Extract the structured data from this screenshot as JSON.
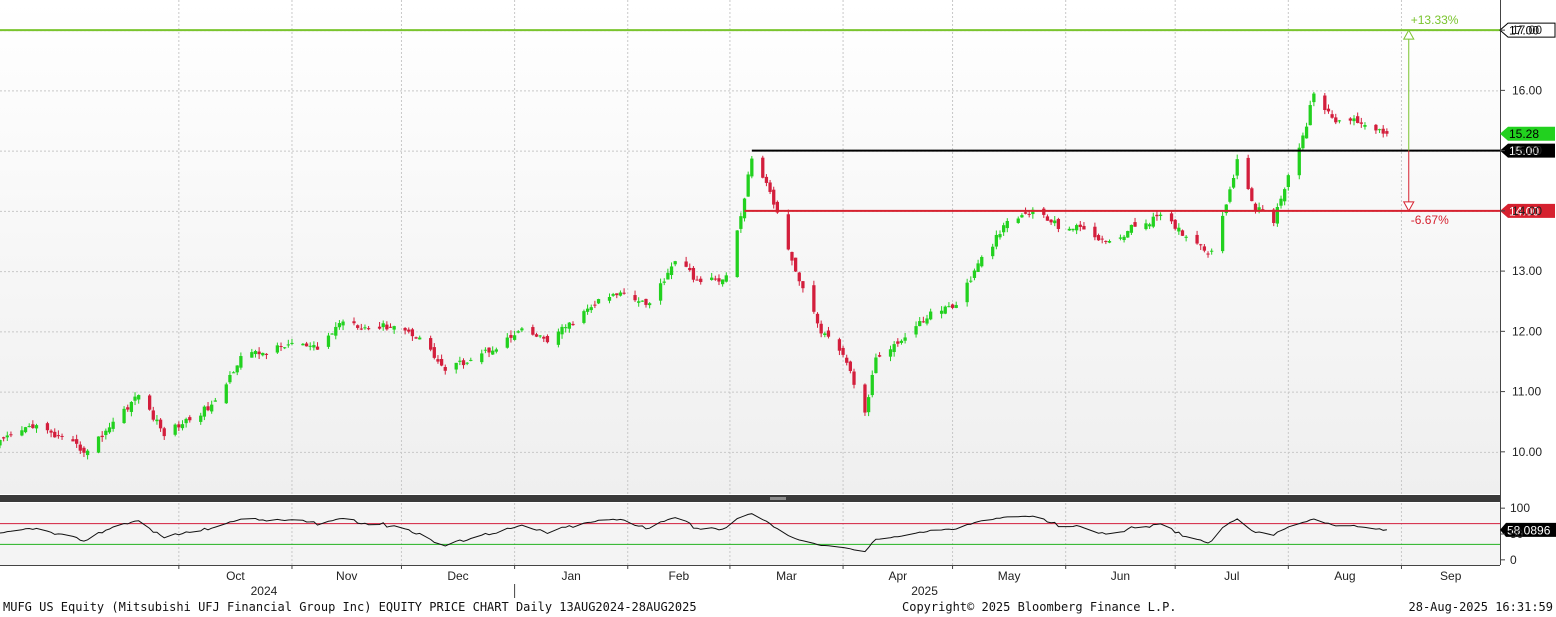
{
  "footer": {
    "left": "MUFG US Equity (Mitsubishi UFJ Financial Group Inc) EQUITY PRICE CHART  Daily 13AUG2024-28AUG2025",
    "center": "Copyright© 2025 Bloomberg Finance L.P.",
    "right": "28-Aug-2025 16:31:59"
  },
  "colors": {
    "up": "#22d11f",
    "down": "#d31e3c",
    "upper_target": "#7ac42e",
    "lower_target": "#d6212f",
    "support": "#000000",
    "last_price_tag": "#22d11f"
  },
  "chart_data": [
    {
      "type": "candlestick",
      "title": "",
      "x_range": [
        "2024-08-13",
        "2025-09-28"
      ],
      "x_ticks": [
        {
          "date": "2024-10-01",
          "label": "Oct"
        },
        {
          "date": "2024-11-01",
          "label": "Nov"
        },
        {
          "date": "2024-12-01",
          "label": "Dec"
        },
        {
          "date": "2025-01-01",
          "label": "Jan"
        },
        {
          "date": "2025-02-01",
          "label": "Feb"
        },
        {
          "date": "2025-03-01",
          "label": "Mar"
        },
        {
          "date": "2025-04-01",
          "label": "Apr"
        },
        {
          "date": "2025-05-01",
          "label": "May"
        },
        {
          "date": "2025-06-01",
          "label": "Jun"
        },
        {
          "date": "2025-07-01",
          "label": "Jul"
        },
        {
          "date": "2025-08-01",
          "label": "Aug"
        },
        {
          "date": "2025-09-01",
          "label": "Sep"
        }
      ],
      "year_labels": [
        {
          "date": "2024-11-01",
          "label": "2024"
        },
        {
          "date": "2025-05-01",
          "label": "2025"
        }
      ],
      "year_boundary": "2025-01-01",
      "y_range": [
        9.3,
        17.5
      ],
      "y_ticks": [
        10,
        11,
        12,
        13,
        14,
        15,
        16,
        17
      ],
      "y_tick_labels": [
        "10.00",
        "11.00",
        "12.00",
        "13.00",
        "14.00",
        "15.00",
        "16.00",
        "17.00"
      ],
      "grid": true,
      "close_anchors": [
        [
          "2024-08-13",
          10.15
        ],
        [
          "2024-08-22",
          10.45
        ],
        [
          "2024-08-30",
          10.2
        ],
        [
          "2024-09-06",
          10.0
        ],
        [
          "2024-09-13",
          10.5
        ],
        [
          "2024-09-20",
          10.95
        ],
        [
          "2024-09-27",
          10.3
        ],
        [
          "2024-10-04",
          10.55
        ],
        [
          "2024-10-11",
          10.8
        ],
        [
          "2024-10-18",
          11.6
        ],
        [
          "2024-10-25",
          11.65
        ],
        [
          "2024-11-01",
          11.8
        ],
        [
          "2024-11-08",
          11.7
        ],
        [
          "2024-11-15",
          12.2
        ],
        [
          "2024-11-22",
          12.05
        ],
        [
          "2024-11-29",
          12.1
        ],
        [
          "2024-12-06",
          11.9
        ],
        [
          "2024-12-13",
          11.35
        ],
        [
          "2024-12-20",
          11.55
        ],
        [
          "2024-12-27",
          11.75
        ],
        [
          "2025-01-03",
          12.0
        ],
        [
          "2025-01-10",
          11.85
        ],
        [
          "2025-01-17",
          12.15
        ],
        [
          "2025-01-24",
          12.5
        ],
        [
          "2025-01-31",
          12.65
        ],
        [
          "2025-02-07",
          12.45
        ],
        [
          "2025-02-14",
          13.2
        ],
        [
          "2025-02-21",
          12.8
        ],
        [
          "2025-02-28",
          12.9
        ],
        [
          "2025-03-04",
          13.9
        ],
        [
          "2025-03-07",
          14.9
        ],
        [
          "2025-03-12",
          14.3
        ],
        [
          "2025-03-14",
          14.0
        ],
        [
          "2025-03-19",
          13.0
        ],
        [
          "2025-03-26",
          12.0
        ],
        [
          "2025-04-02",
          11.5
        ],
        [
          "2025-04-07",
          10.6
        ],
        [
          "2025-04-10",
          11.6
        ],
        [
          "2025-04-17",
          11.85
        ],
        [
          "2025-04-25",
          12.3
        ],
        [
          "2025-05-02",
          12.45
        ],
        [
          "2025-05-09",
          13.2
        ],
        [
          "2025-05-16",
          13.8
        ],
        [
          "2025-05-23",
          14.0
        ],
        [
          "2025-05-30",
          13.75
        ],
        [
          "2025-06-06",
          13.7
        ],
        [
          "2025-06-13",
          13.45
        ],
        [
          "2025-06-20",
          13.75
        ],
        [
          "2025-06-27",
          13.9
        ],
        [
          "2025-07-04",
          13.6
        ],
        [
          "2025-07-11",
          13.3
        ],
        [
          "2025-07-18",
          14.8
        ],
        [
          "2025-07-23",
          14.05
        ],
        [
          "2025-07-28",
          13.85
        ],
        [
          "2025-08-01",
          14.6
        ],
        [
          "2025-08-06",
          15.4
        ],
        [
          "2025-08-08",
          16.0
        ],
        [
          "2025-08-13",
          15.5
        ],
        [
          "2025-08-20",
          15.5
        ],
        [
          "2025-08-28",
          15.28
        ]
      ],
      "last_price": 15.28,
      "last_price_label": "15.28",
      "horizontal_lines": [
        {
          "value": 17.0,
          "label": "17.00",
          "start": "2024-08-13",
          "color": "#7ac42e"
        },
        {
          "value": 15.0,
          "label": "15.00",
          "start": "2025-03-07",
          "color": "#000000"
        },
        {
          "value": 14.0,
          "label": "14.00",
          "start": "2025-03-05",
          "color": "#d6212f"
        }
      ],
      "annotations": [
        {
          "text": "+13.33%",
          "from": 15.0,
          "to": 17.0,
          "date": "2025-09-03",
          "color": "#7ac42e"
        },
        {
          "text": "-6.67%",
          "from": 15.0,
          "to": 14.0,
          "date": "2025-09-03",
          "color": "#d6212f"
        }
      ]
    },
    {
      "type": "line",
      "title": "",
      "series": [
        {
          "name": "",
          "last": 58.0896,
          "last_label": "58.0896"
        }
      ],
      "y_range": [
        -10,
        110
      ],
      "y_ticks": [
        0,
        50,
        100
      ],
      "y_tick_labels": [
        "0",
        "50",
        "100"
      ],
      "reference_lines": [
        {
          "value": 70,
          "color": "#d31e3c"
        },
        {
          "value": 30,
          "color": "#22b21f"
        }
      ]
    }
  ]
}
